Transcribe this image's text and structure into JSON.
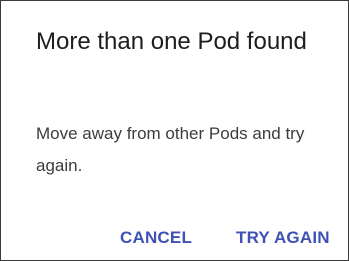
{
  "dialog": {
    "title": "More than one Pod found",
    "message": "Move away from other Pods and try again.",
    "cancel_label": "CANCEL",
    "retry_label": "TRY AGAIN"
  },
  "colors": {
    "accent": "#3f51b5",
    "title_text": "#1d1d1d",
    "body_text": "#3c3c3c",
    "background": "#ffffff"
  }
}
